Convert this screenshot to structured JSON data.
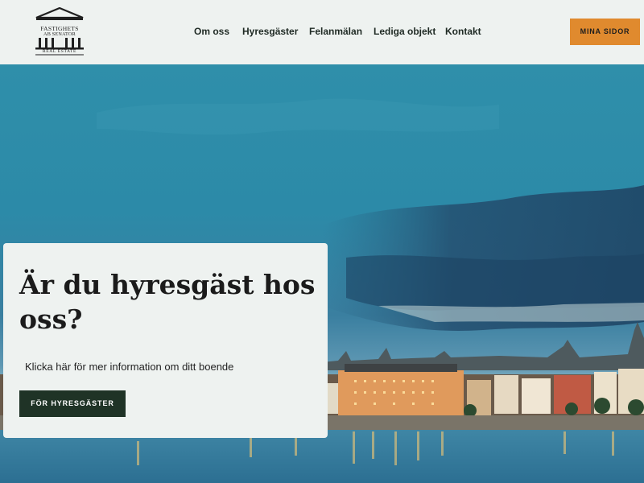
{
  "brand": {
    "logo_line1": "FASTIGHETS",
    "logo_line2": "AB SENATOR",
    "logo_line3": "REAL ESTATE"
  },
  "nav": {
    "items": [
      {
        "label": "Om oss"
      },
      {
        "label": "Hyresgäster"
      },
      {
        "label": "Felanmälan"
      },
      {
        "label": "Lediga objekt"
      },
      {
        "label": "Kontakt"
      }
    ],
    "cta_label": "MINA SIDOR"
  },
  "hero": {
    "title": "Är du hyresgäst hos oss?",
    "subtitle": "Klicka här för mer information om ditt boende",
    "button_label": "FÖR HYRESGÄSTER"
  },
  "colors": {
    "accent": "#e08a2e",
    "dark_green": "#1f3326",
    "background": "#eef2f0"
  }
}
